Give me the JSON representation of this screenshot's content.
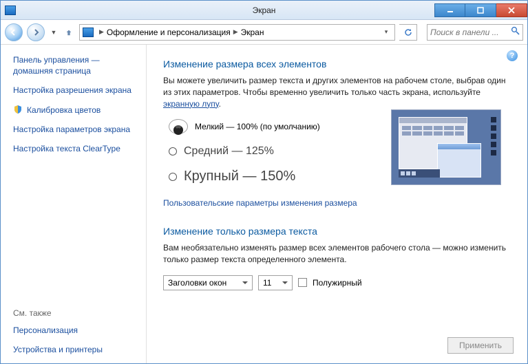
{
  "window": {
    "title": "Экран"
  },
  "nav": {
    "breadcrumb1": "Оформление и персонализация",
    "breadcrumb2": "Экран",
    "search_placeholder": "Поиск в панели ..."
  },
  "sidebar": {
    "links": [
      "Панель управления — домашняя страница",
      "Настройка разрешения экрана",
      "Калибровка цветов",
      "Настройка параметров экрана",
      "Настройка текста ClearType"
    ],
    "seealso_header": "См. также",
    "seealso": [
      "Персонализация",
      "Устройства и принтеры"
    ]
  },
  "main": {
    "h1": "Изменение размера всех элементов",
    "desc_a": "Вы можете увеличить размер текста и других элементов на рабочем столе, выбрав один из этих параметров. Чтобы временно увеличить только часть экрана, используйте ",
    "desc_link": "экранную лупу",
    "desc_b": ".",
    "options": [
      {
        "label": "Мелкий — 100% (по умолчанию)",
        "selected": true
      },
      {
        "label": "Средний — 125%",
        "selected": false
      },
      {
        "label": "Крупный — 150%",
        "selected": false
      }
    ],
    "custom_link": "Пользовательские параметры изменения размера",
    "h2": "Изменение только размера текста",
    "desc2": "Вам необязательно изменять размер всех элементов рабочего стола — можно изменить только размер текста определенного элемента.",
    "select_element": "Заголовки окон",
    "select_size": "11",
    "bold_label": "Полужирный",
    "apply": "Применить"
  }
}
